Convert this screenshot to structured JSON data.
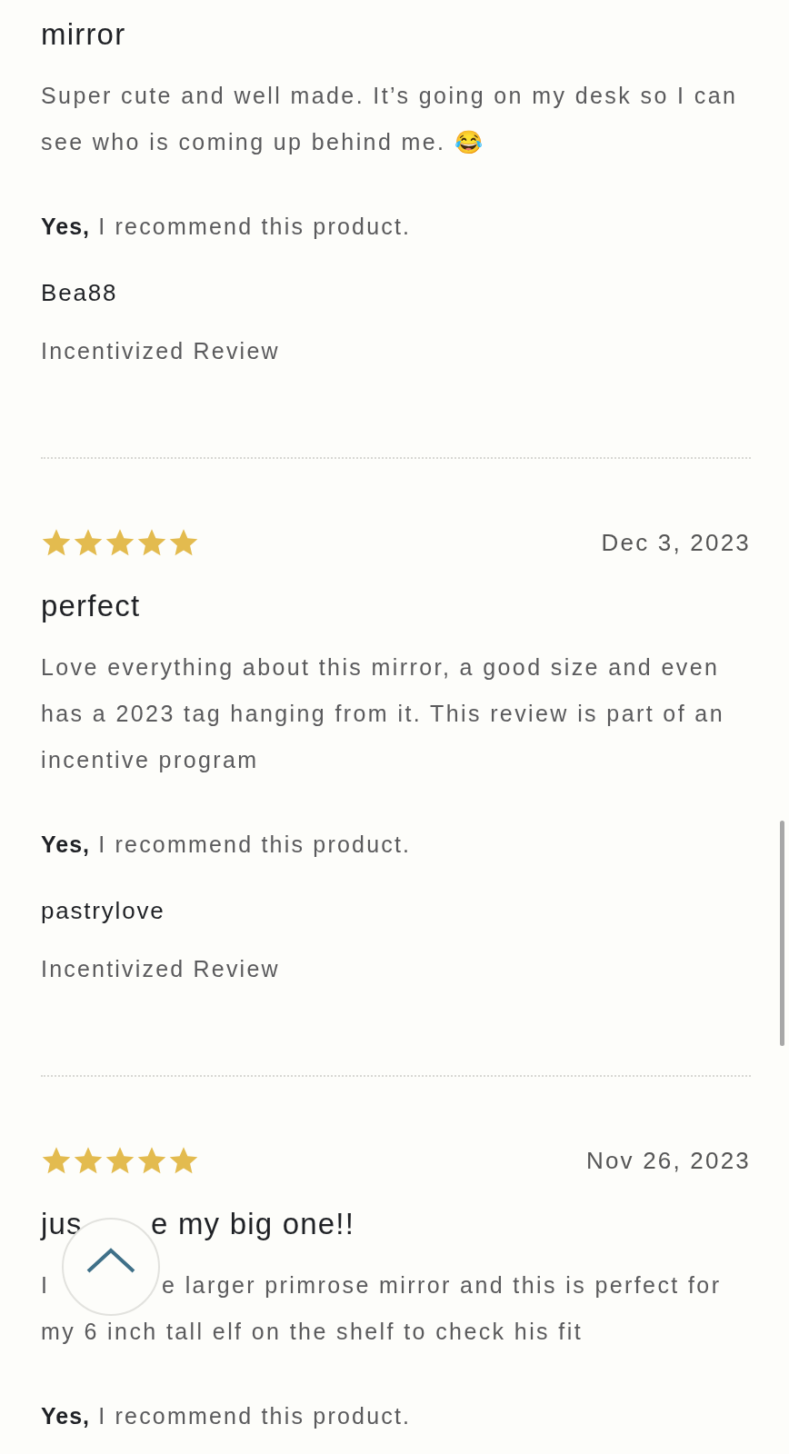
{
  "reviews": [
    {
      "title": "mirror",
      "body": "Super cute and well made. It’s going on my desk so I can see who is coming up behind me. 😂",
      "recommendation": "**Yes,** I recommend this product.",
      "author": "Bea88",
      "tag": "Incentivized Review"
    },
    {
      "stars": 5,
      "date": "Dec 3, 2023",
      "title": "perfect",
      "body": "Love everything about this mirror, a good size and even has a 2023 tag hanging from it. This review is part of an incentive program",
      "recommendation": "**Yes,** I recommend this product.",
      "author": "pastrylove",
      "tag": "Incentivized Review"
    },
    {
      "stars": 5,
      "date": "Nov 26, 2023",
      "title_parts": [
        "jus",
        "e my big one!!"
      ],
      "body_lines": [
        [
          "I",
          "e larger primrose mirror and this is perfect for"
        ],
        [
          "my 6 inch tall elf on the shelf to check his fit"
        ]
      ],
      "recommendation": "**Yes,** I recommend this product."
    }
  ]
}
